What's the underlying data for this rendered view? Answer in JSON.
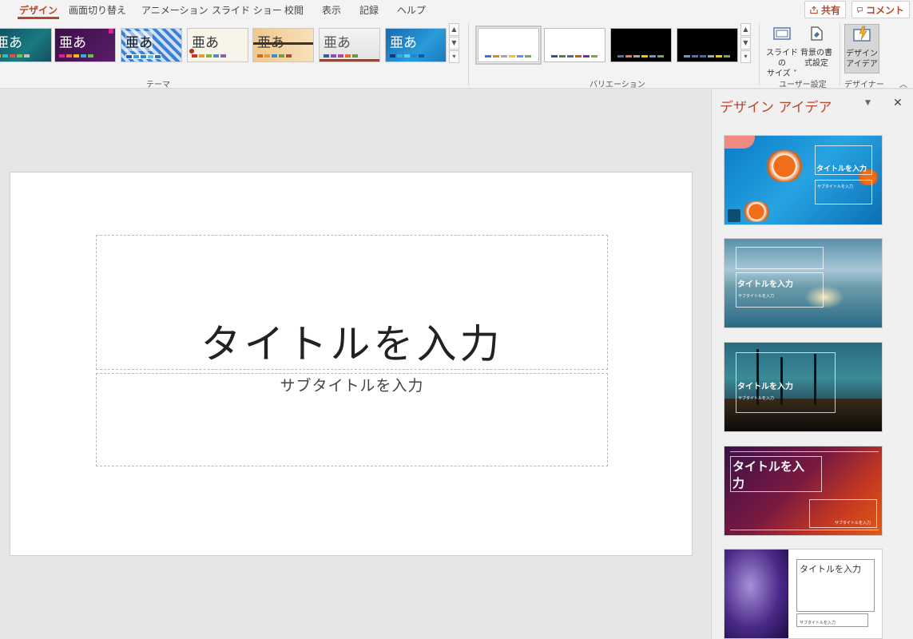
{
  "ribbon": {
    "tabs": [
      "デザイン",
      "画面切り替え",
      "アニメーション",
      "スライド ショー",
      "校閲",
      "表示",
      "記録",
      "ヘルプ"
    ],
    "share_label": "共有",
    "comment_label": "コメント",
    "groups": {
      "themes": "テーマ",
      "variations": "バリエーション",
      "customize": "ユーザー設定",
      "designer": "デザイナー"
    },
    "theme_glyph": "亜あ",
    "buttons": {
      "slide_size_line1": "スライドの",
      "slide_size_line2": "サイズ ˅",
      "background_line1": "背景の書",
      "background_line2": "式設定",
      "design_ideas_line1": "デザイン",
      "design_ideas_line2": "アイデア"
    }
  },
  "slide": {
    "title": "タイトルを入力",
    "subtitle": "サブタイトルを入力"
  },
  "pane": {
    "title": "デザイン アイデア",
    "ideas": [
      {
        "title": "タイトルを入力",
        "subtitle": "サブタイトルを入力"
      },
      {
        "title": "タイトルを入力",
        "subtitle": "サブタイトルを入力"
      },
      {
        "title": "タイトルを入力",
        "subtitle": "サブタイトルを入力"
      },
      {
        "title_line1": "タイトルを入",
        "title_line2": "力",
        "subtitle": "サブタイトルを入力"
      },
      {
        "title": "タイトルを入力",
        "subtitle": "サブタイトルを入力"
      }
    ]
  }
}
